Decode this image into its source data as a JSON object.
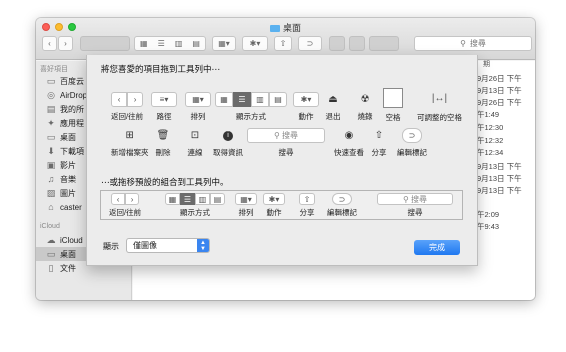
{
  "window": {
    "title": "桌面"
  },
  "toolbar": {
    "back": "‹",
    "forward": "›",
    "search_placeholder": "搜尋"
  },
  "sidebar": {
    "favorites_header": "喜好項目",
    "items": [
      "百度云",
      "AirDrop",
      "我的所",
      "應用程",
      "桌面",
      "下載項",
      "影片",
      "音樂",
      "圖片",
      "caster"
    ],
    "icloud_header": "iCloud",
    "icloud_items": [
      "iCloud",
      "桌面",
      "文件"
    ]
  },
  "file_list": {
    "column_header": "期",
    "dates": [
      "9月26日 下午",
      "9月13日 下午",
      "9月26日 下午",
      "午1:49",
      "午12:30",
      "午12:32",
      "午12:34",
      "9月13日 下午",
      "9月13日 下午",
      "9月13日 下午",
      "午2:09",
      "午9:43"
    ]
  },
  "sheet": {
    "heading": "將您喜愛的項目拖到工具列中⋯",
    "items": {
      "back_forward": "返回/往前",
      "path": "路徑",
      "arrange": "排列",
      "view": "顯示方式",
      "action": "動作",
      "eject": "退出",
      "burn": "燒錄",
      "space": "空格",
      "flex_space": "可調整的空格",
      "new_folder": "新增檔案夾",
      "delete": "刪除",
      "connect": "連線",
      "get_info": "取得資訊",
      "search": "搜尋",
      "quick_look": "快速查看",
      "share": "分享",
      "edit_tags": "編輯標記"
    },
    "default_heading": "⋯或拖移預設的組合到工具列中。",
    "default_items": {
      "back_forward": "返回/往前",
      "view": "顯示方式",
      "arrange": "排列",
      "action": "動作",
      "share": "分享",
      "edit_tags": "編輯標記",
      "search": "搜尋"
    },
    "show_label": "顯示",
    "show_value": "僅圖像",
    "done": "完成"
  }
}
